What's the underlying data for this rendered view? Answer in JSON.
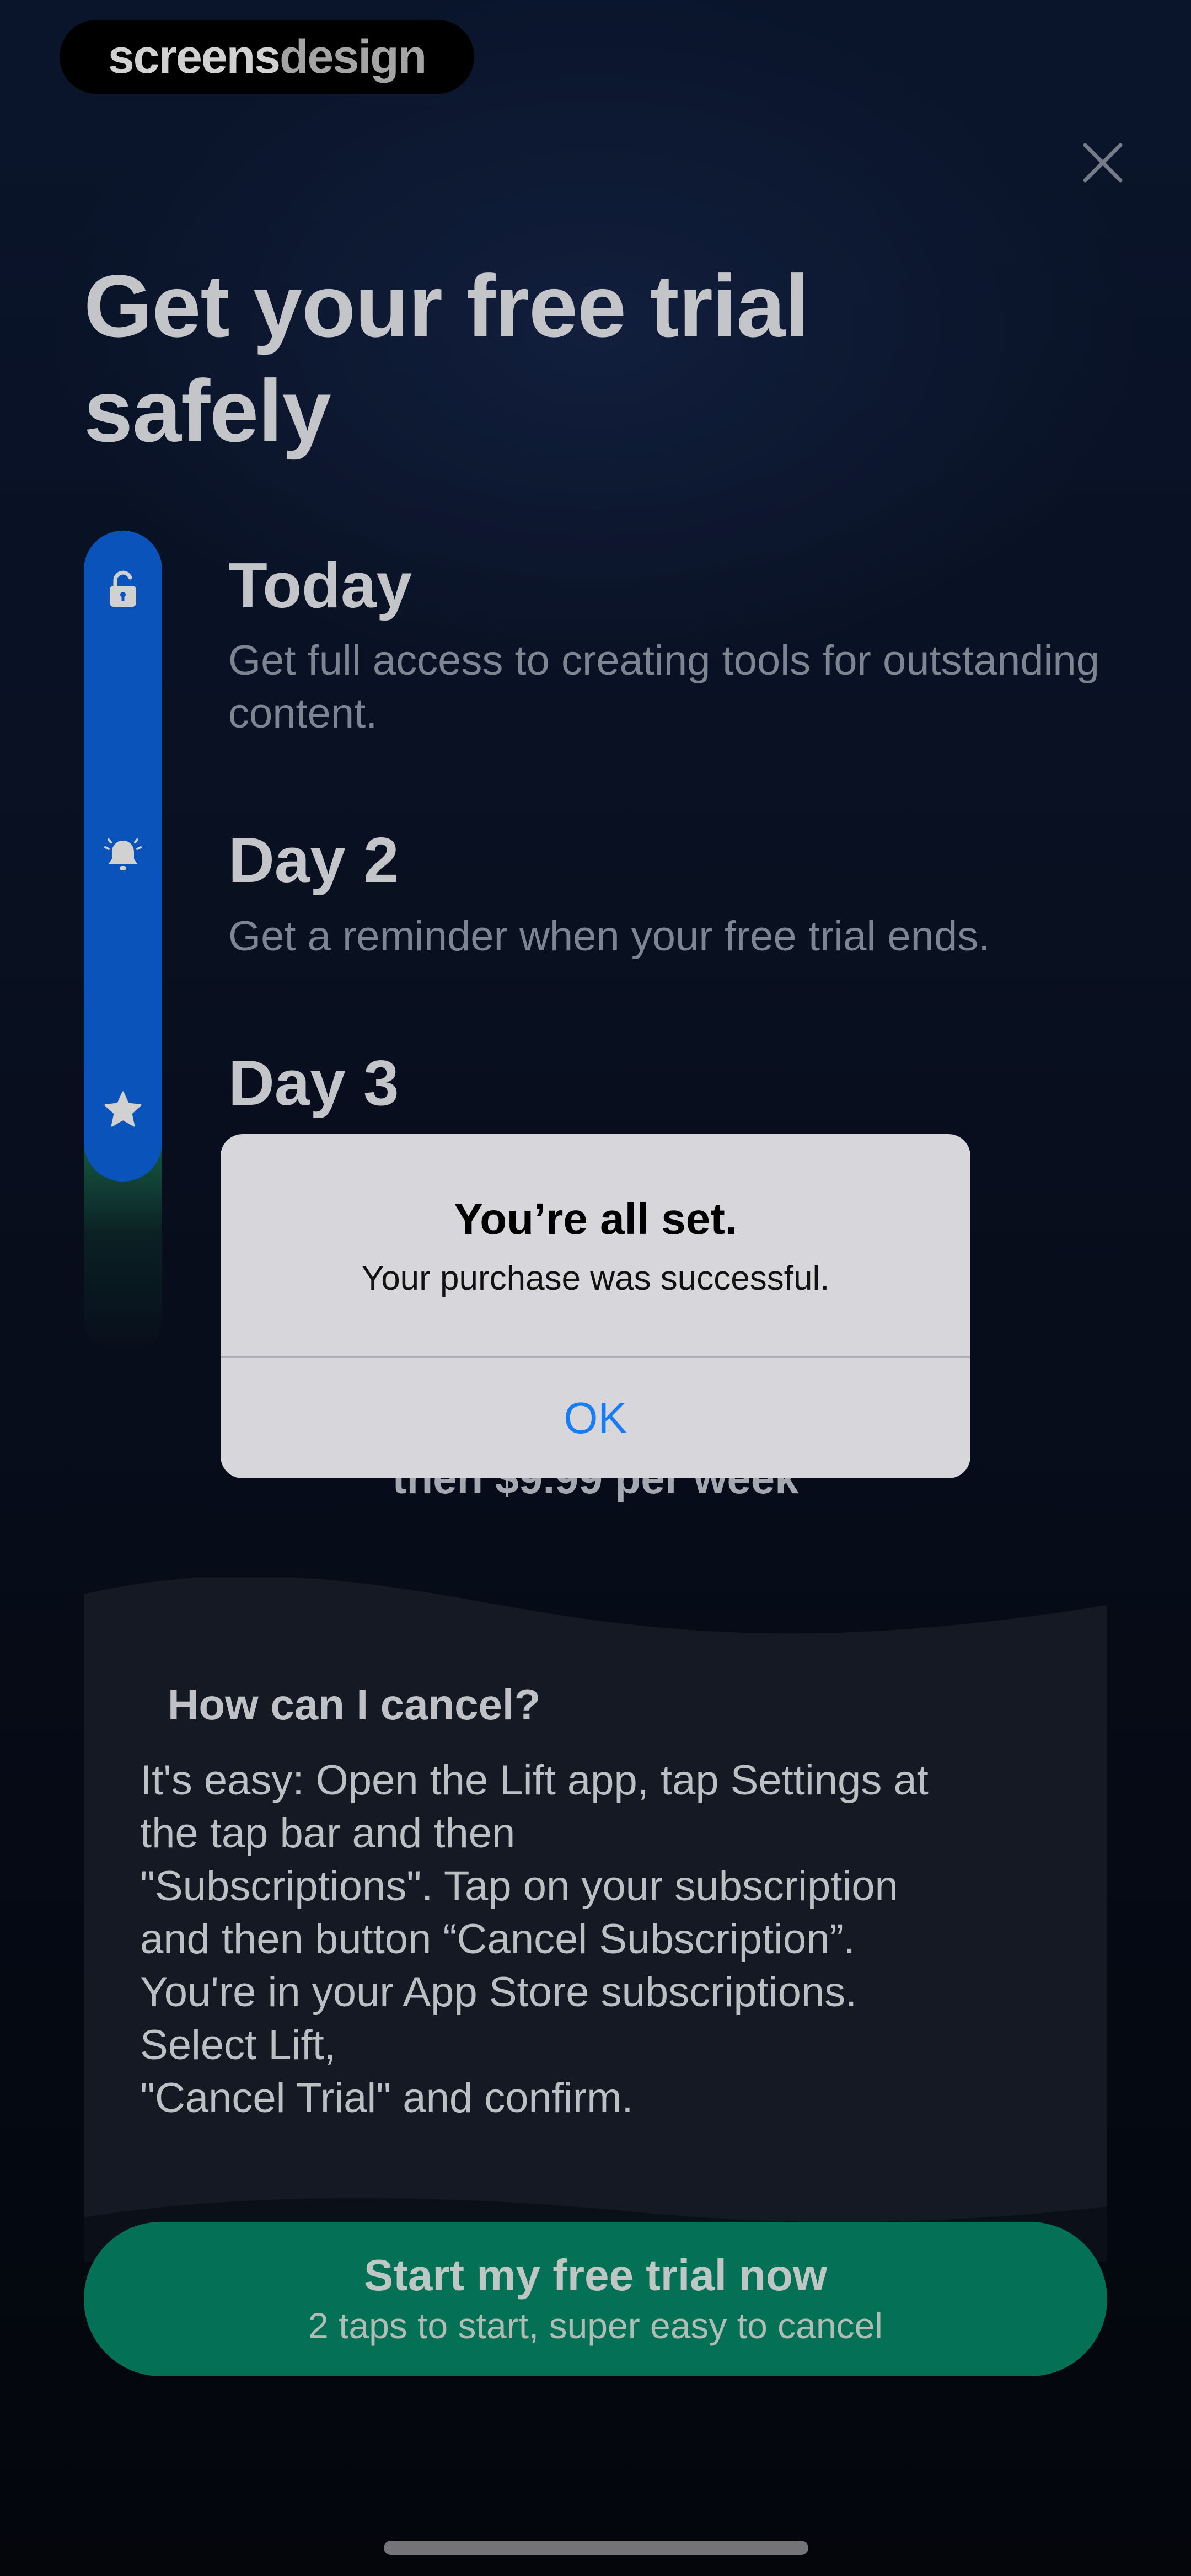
{
  "watermark": {
    "part1": "screens",
    "part2": "design"
  },
  "header": {
    "title": "Get your free trial safely",
    "close_icon": "close-icon"
  },
  "timeline": {
    "steps": [
      {
        "title": "Today",
        "description": "Get full access to creating tools for outstanding content.",
        "icon": "unlock-icon"
      },
      {
        "title": "Day 2",
        "description": "Get a reminder when your free trial ends.",
        "icon": "bell-icon"
      },
      {
        "title": "Day 3",
        "description": "",
        "icon": "star-icon"
      }
    ],
    "bar_color": "#0c66e4"
  },
  "pricing": {
    "text": "then $9.99 per week"
  },
  "cancel_info": {
    "question": "How can I cancel?",
    "answer": "It's easy: Open the Lift app, tap Settings at\nthe tap bar and then\n\"Subscriptions\". Tap on your subscription\nand then button “Cancel Subscription”.\nYou're in your App Store subscriptions.\nSelect Lift,\n\"Cancel Trial\" and confirm."
  },
  "cta": {
    "title": "Start my free trial now",
    "subtitle": "2 taps to start, super easy to cancel",
    "color": "#058a6a"
  },
  "alert": {
    "title": "You’re all set.",
    "message": "Your purchase was successful.",
    "ok_label": "OK",
    "ok_color": "#1a7cf2"
  }
}
